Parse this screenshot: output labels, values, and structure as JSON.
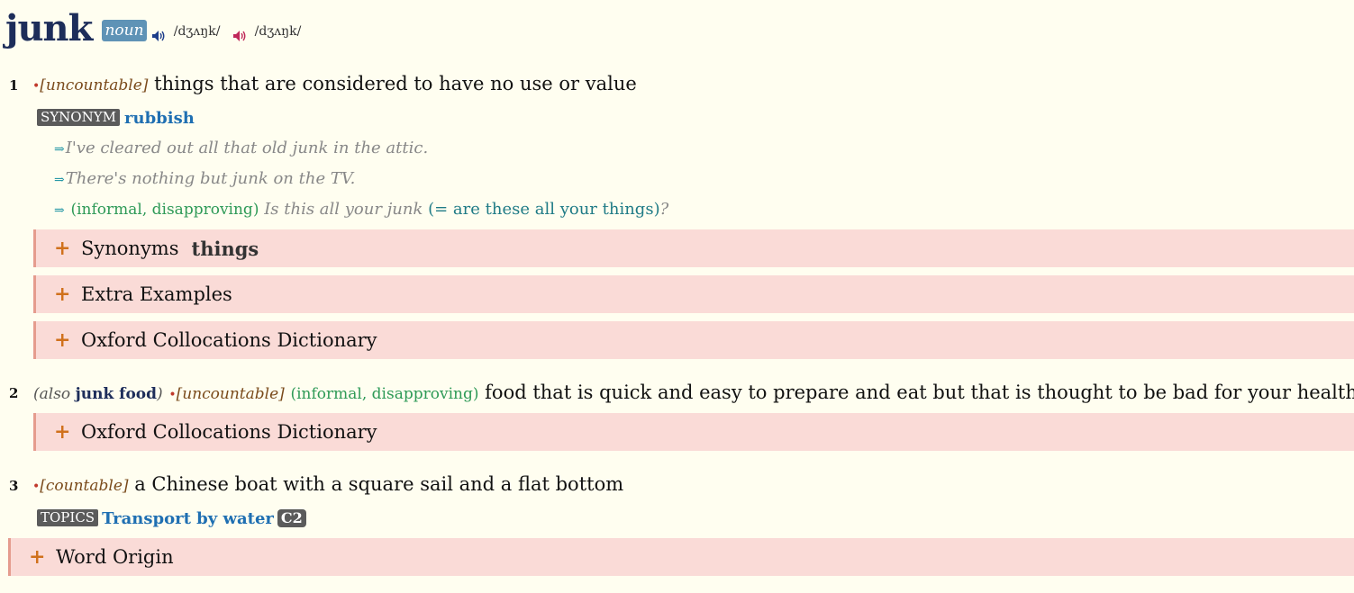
{
  "entry": {
    "headword": "junk",
    "pos": "noun",
    "pron_uk": "/dʒʌŋk/",
    "pron_us": "/dʒʌŋk/"
  },
  "colors": {
    "uk_speaker": "#1d3d8a",
    "us_speaker": "#c0285a",
    "panel_bg": "#fadbd7",
    "panel_border": "#e59c8e",
    "plus": "#d0711c"
  },
  "senses": [
    {
      "num": "1",
      "bullet": "•",
      "grammar": "[uncountable]",
      "definition": "things that are considered to have no use or value",
      "synonym_tag": "SYNONYM",
      "synonym": "rubbish",
      "examples": [
        {
          "arrow": "⇒",
          "text": "I've cleared out all that old junk in the attic."
        },
        {
          "arrow": "⇒",
          "text": "There's nothing but junk on the TV."
        },
        {
          "arrow": "⇒",
          "labels": "(informal, disapproving)",
          "text": "Is this all your junk",
          "gloss": "(= are these all your things)",
          "tail": "?"
        }
      ],
      "panels": [
        {
          "plus": "+",
          "title": "Synonyms",
          "extra": "things"
        },
        {
          "plus": "+",
          "title": "Extra Examples"
        },
        {
          "plus": "+",
          "title": "Oxford Collocations Dictionary"
        }
      ]
    },
    {
      "num": "2",
      "also_open": "(also",
      "also_word": "junk food",
      "also_close": ")",
      "bullet": "•",
      "grammar": "[uncountable]",
      "labels": "(informal, disapproving)",
      "definition": "food that is quick and easy to prepare and eat but that is thought to be bad for your health",
      "panels": [
        {
          "plus": "+",
          "title": "Oxford Collocations Dictionary"
        }
      ]
    },
    {
      "num": "3",
      "bullet": "•",
      "grammar": "[countable]",
      "definition": "a Chinese boat with a square sail and a flat bottom",
      "topics_tag": "TOPICS",
      "topic": "Transport by water",
      "cefr": "C2"
    }
  ],
  "word_origin": {
    "plus": "+",
    "title": "Word Origin"
  }
}
